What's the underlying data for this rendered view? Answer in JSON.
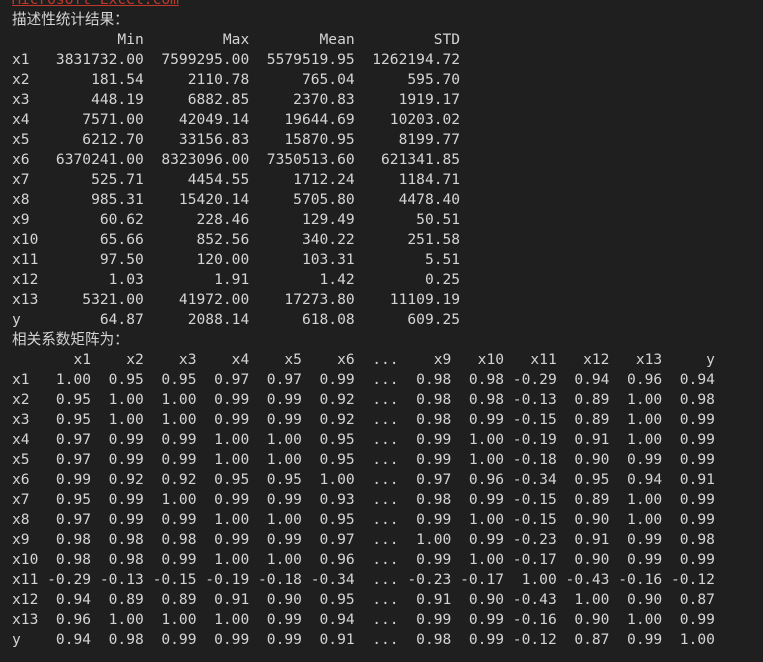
{
  "console": {
    "previous_line": "Microsoft Excel.com",
    "stats_title": "描述性统计结果：",
    "stats_header": "            Min         Max        Mean         STD",
    "stats_rows": [
      "x1   3831732.00  7599295.00  5579519.95  1262194.72",
      "x2       181.54     2110.78      765.04      595.70",
      "x3       448.19     6882.85     2370.83     1919.17",
      "x4      7571.00    42049.14    19644.69    10203.02",
      "x5      6212.70    33156.83    15870.95     8199.77",
      "x6   6370241.00  8323096.00  7350513.60   621341.85",
      "x7       525.71     4454.55     1712.24     1184.71",
      "x8       985.31    15420.14     5705.80     4478.40",
      "x9        60.62      228.46      129.49       50.51",
      "x10       65.66      852.56      340.22      251.58",
      "x11       97.50      120.00      103.31        5.51",
      "x12        1.03        1.91        1.42        0.25",
      "x13     5321.00    41972.00    17273.80    11109.19",
      "y         64.87     2088.14      618.08      609.25"
    ],
    "corr_title": "相关系数矩阵为：",
    "corr_header": "       x1    x2    x3    x4    x5    x6  ...    x9   x10   x11   x12   x13     y",
    "corr_rows": [
      "x1   1.00  0.95  0.95  0.97  0.97  0.99  ...  0.98  0.98 -0.29  0.94  0.96  0.94",
      "x2   0.95  1.00  1.00  0.99  0.99  0.92  ...  0.98  0.98 -0.13  0.89  1.00  0.98",
      "x3   0.95  1.00  1.00  0.99  0.99  0.92  ...  0.98  0.99 -0.15  0.89  1.00  0.99",
      "x4   0.97  0.99  0.99  1.00  1.00  0.95  ...  0.99  1.00 -0.19  0.91  1.00  0.99",
      "x5   0.97  0.99  0.99  1.00  1.00  0.95  ...  0.99  1.00 -0.18  0.90  0.99  0.99",
      "x6   0.99  0.92  0.92  0.95  0.95  1.00  ...  0.97  0.96 -0.34  0.95  0.94  0.91",
      "x7   0.95  0.99  1.00  0.99  0.99  0.93  ...  0.98  0.99 -0.15  0.89  1.00  0.99",
      "x8   0.97  0.99  0.99  1.00  1.00  0.95  ...  0.99  1.00 -0.15  0.90  1.00  0.99",
      "x9   0.98  0.98  0.98  0.99  0.99  0.97  ...  1.00  0.99 -0.23  0.91  0.99  0.98",
      "x10  0.98  0.98  0.99  1.00  1.00  0.96  ...  0.99  1.00 -0.17  0.90  0.99  0.99",
      "x11 -0.29 -0.13 -0.15 -0.19 -0.18 -0.34  ... -0.23 -0.17  1.00 -0.43 -0.16 -0.12",
      "x12  0.94  0.89  0.89  0.91  0.90  0.95  ...  0.91  0.90 -0.43  1.00  0.90  0.87",
      "x13  0.96  1.00  1.00  1.00  0.99  0.94  ...  0.99  0.99 -0.16  0.90  1.00  0.99",
      "y    0.94  0.98  0.99  0.99  0.99  0.91  ...  0.98  0.99 -0.12  0.87  0.99  1.00"
    ]
  }
}
